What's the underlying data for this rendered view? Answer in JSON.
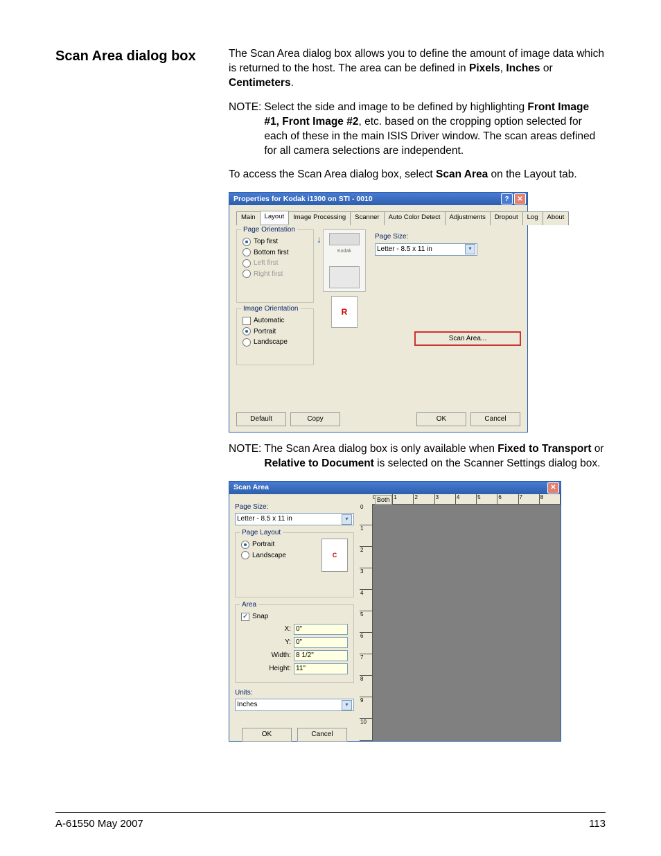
{
  "heading": "Scan Area dialog box",
  "para1_a": "The Scan Area dialog box allows you to define the amount of image data which is returned to the host. The area can be defined in ",
  "para1_b1": "Pixels",
  "para1_b2": "Inches",
  "para1_b3": "Centimeters",
  "note1_label": "NOTE:",
  "note1_a": "Select the side and image to be defined by highlighting ",
  "note1_b1": "Front Image #1, Front Image #2",
  "note1_c": ", etc. based on the cropping option selected for each of these in the main ISIS Driver window. The scan areas defined for all camera selections are independent.",
  "para2_a": "To access the Scan Area dialog box, select ",
  "para2_b": "Scan Area",
  "para2_c": " on the Layout tab.",
  "note2_label": "NOTE:",
  "note2_a": "The Scan Area dialog box is only available when ",
  "note2_b1": "Fixed to Transport",
  "note2_or": " or ",
  "note2_b2": "Relative to Document",
  "note2_c": " is selected on the Scanner Settings dialog box.",
  "dlg1": {
    "title": "Properties for Kodak i1300 on STI - 0010",
    "tabs": [
      "Main",
      "Layout",
      "Image Processing",
      "Scanner",
      "Auto Color Detect",
      "Adjustments",
      "Dropout",
      "Log",
      "About"
    ],
    "active_tab": 1,
    "page_orientation_legend": "Page Orientation",
    "radios_po": [
      "Top first",
      "Bottom first",
      "Left first",
      "Right first"
    ],
    "image_orientation_legend": "Image Orientation",
    "auto_label": "Automatic",
    "radios_io": [
      "Portrait",
      "Landscape"
    ],
    "page_size_label": "Page Size:",
    "page_size_value": "Letter - 8.5 x 11 in",
    "scan_area_btn": "Scan Area...",
    "footer_left": [
      "Default",
      "Copy"
    ],
    "footer_right": [
      "OK",
      "Cancel"
    ]
  },
  "dlg2": {
    "title": "Scan Area",
    "page_size_label": "Page Size:",
    "page_size_value": "Letter - 8.5 x 11 in",
    "page_layout_legend": "Page Layout",
    "radios": [
      "Portrait",
      "Landscape"
    ],
    "area_legend": "Area",
    "snap_label": "Snap",
    "x_label": "X:",
    "y_label": "Y:",
    "w_label": "Width:",
    "h_label": "Height:",
    "x_val": "0\"",
    "y_val": "0\"",
    "w_val": "8 1/2\"",
    "h_val": "11\"",
    "units_label": "Units:",
    "units_value": "Inches",
    "ok": "OK",
    "cancel": "Cancel",
    "both": "Both",
    "hruler": [
      "0",
      "1",
      "2",
      "3",
      "4",
      "5",
      "6",
      "7",
      "8"
    ],
    "vruler": [
      "0",
      "1",
      "2",
      "3",
      "4",
      "5",
      "6",
      "7",
      "8",
      "9",
      "10"
    ]
  },
  "footer_left": "A-61550  May 2007",
  "footer_right": "113"
}
